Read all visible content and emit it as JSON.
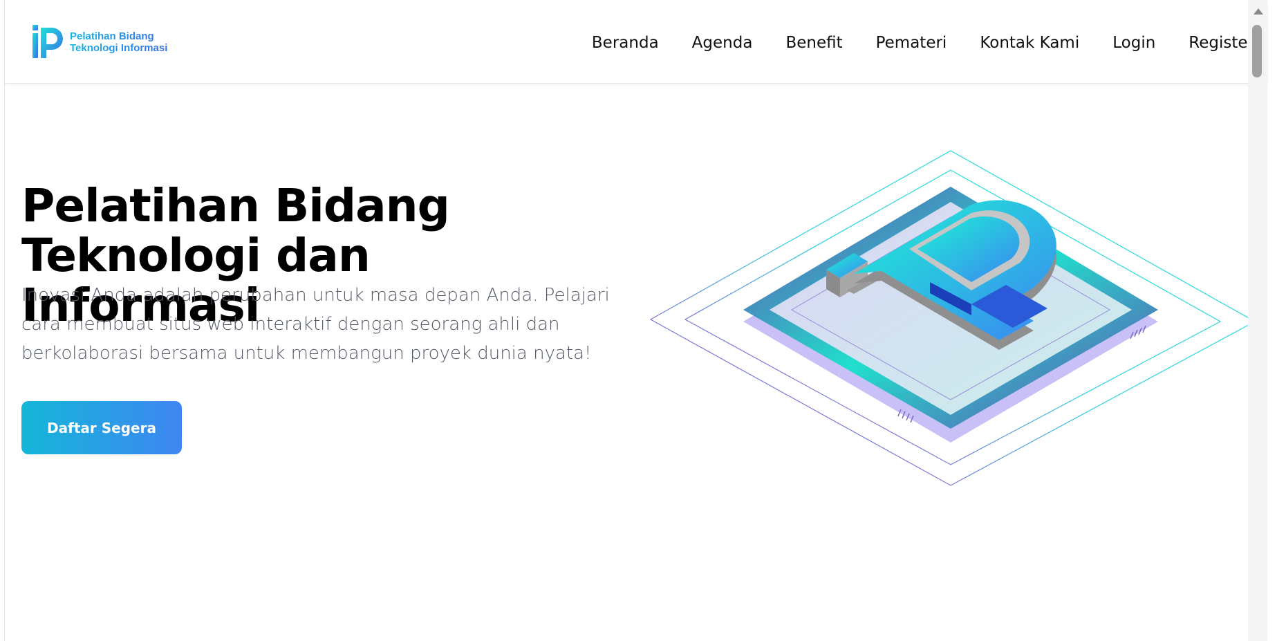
{
  "brand": {
    "line1": "Pelatihan Bidang",
    "line2": "Teknologi Informasi"
  },
  "nav": {
    "items": [
      {
        "label": "Beranda"
      },
      {
        "label": "Agenda"
      },
      {
        "label": "Benefit"
      },
      {
        "label": "Pemateri"
      },
      {
        "label": "Kontak Kami"
      },
      {
        "label": "Login"
      },
      {
        "label": "Register"
      }
    ]
  },
  "hero": {
    "title_line1": "Pelatihan Bidang",
    "title_line2": "Teknologi dan Informasi",
    "description": "Inovasi Anda adalah perubahan untuk masa depan Anda. Pelajari cara membuat situs web interaktif dengan seorang ahli dan berkolaborasi bersama untuk membangun proyek dunia nyata!",
    "cta_label": "Daftar Segera"
  },
  "colors": {
    "accent_start": "#14b6d8",
    "accent_end": "#3f86f2",
    "logo_teal": "#19e6d4",
    "purple": "#6a3fb0"
  },
  "icons": {
    "logo": "ip-logo-icon",
    "hero_art": "ip-chip-illustration",
    "scroll_up": "scroll-up-arrow-icon"
  }
}
